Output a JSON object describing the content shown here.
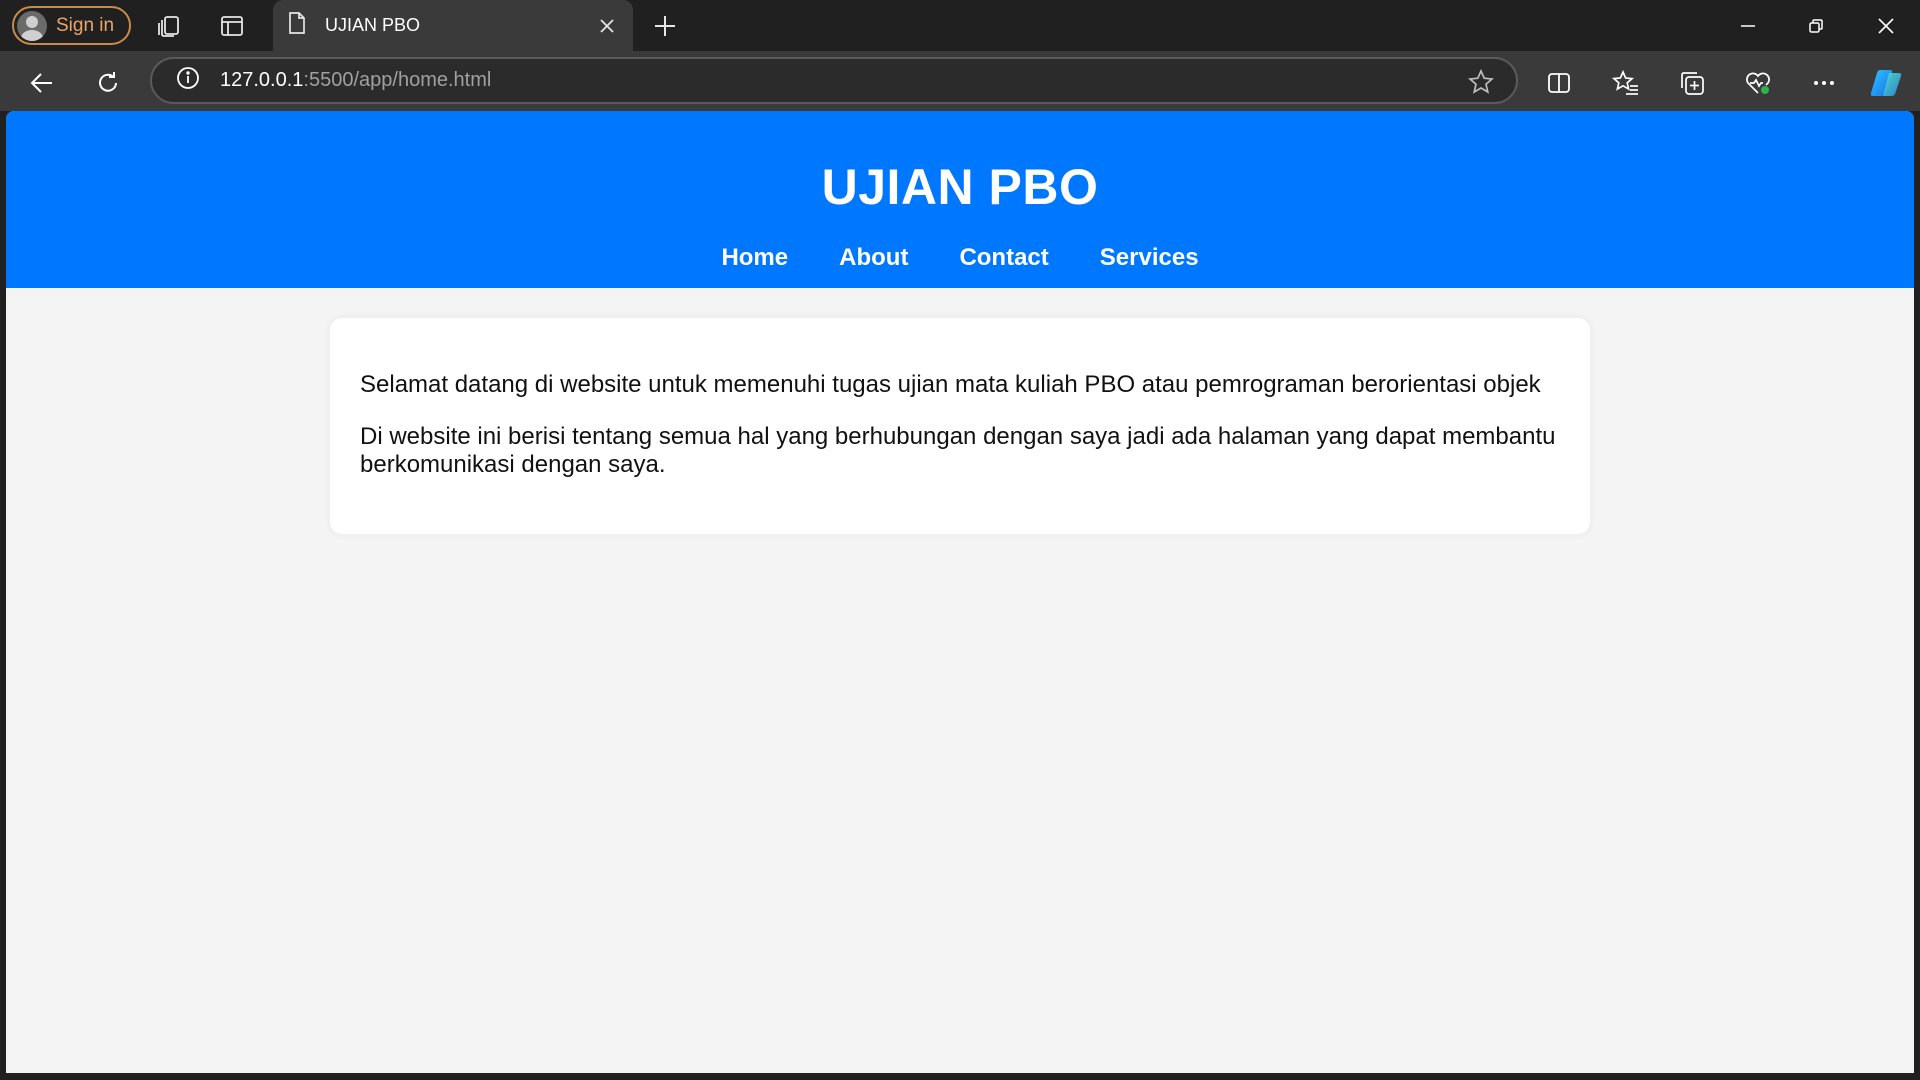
{
  "browser": {
    "sign_in_label": "Sign in",
    "active_tab_title": "UJIAN PBO",
    "url_host": "127.0.0.1",
    "url_rest": ":5500/app/home.html"
  },
  "page": {
    "title": "UJIAN PBO",
    "nav": [
      "Home",
      "About",
      "Contact",
      "Services"
    ],
    "paragraphs": [
      "Selamat datang di website untuk memenuhi tugas ujian mata kuliah PBO atau pemrograman berorientasi objek",
      "Di website ini berisi tentang semua hal yang berhubungan dengan saya jadi ada halaman yang dapat membantu berkomunikasi dengan saya."
    ]
  },
  "colors": {
    "header_blue": "#0077ff",
    "page_bg": "#f4f4f4",
    "browser_chrome": "#202020",
    "toolbar": "#3a3a3a"
  },
  "icons": {
    "tab_strip": [
      "profile-avatar-icon",
      "workspaces-icon",
      "tab-actions-icon",
      "document-icon",
      "close-icon",
      "new-tab-plus-icon"
    ],
    "window": [
      "minimize-icon",
      "restore-icon",
      "window-close-icon"
    ],
    "toolbar": [
      "back-arrow-icon",
      "refresh-icon",
      "site-info-icon",
      "favorite-star-icon",
      "split-screen-icon",
      "favorites-icon",
      "collections-icon",
      "browser-essentials-icon",
      "more-icon",
      "copilot-icon"
    ]
  }
}
